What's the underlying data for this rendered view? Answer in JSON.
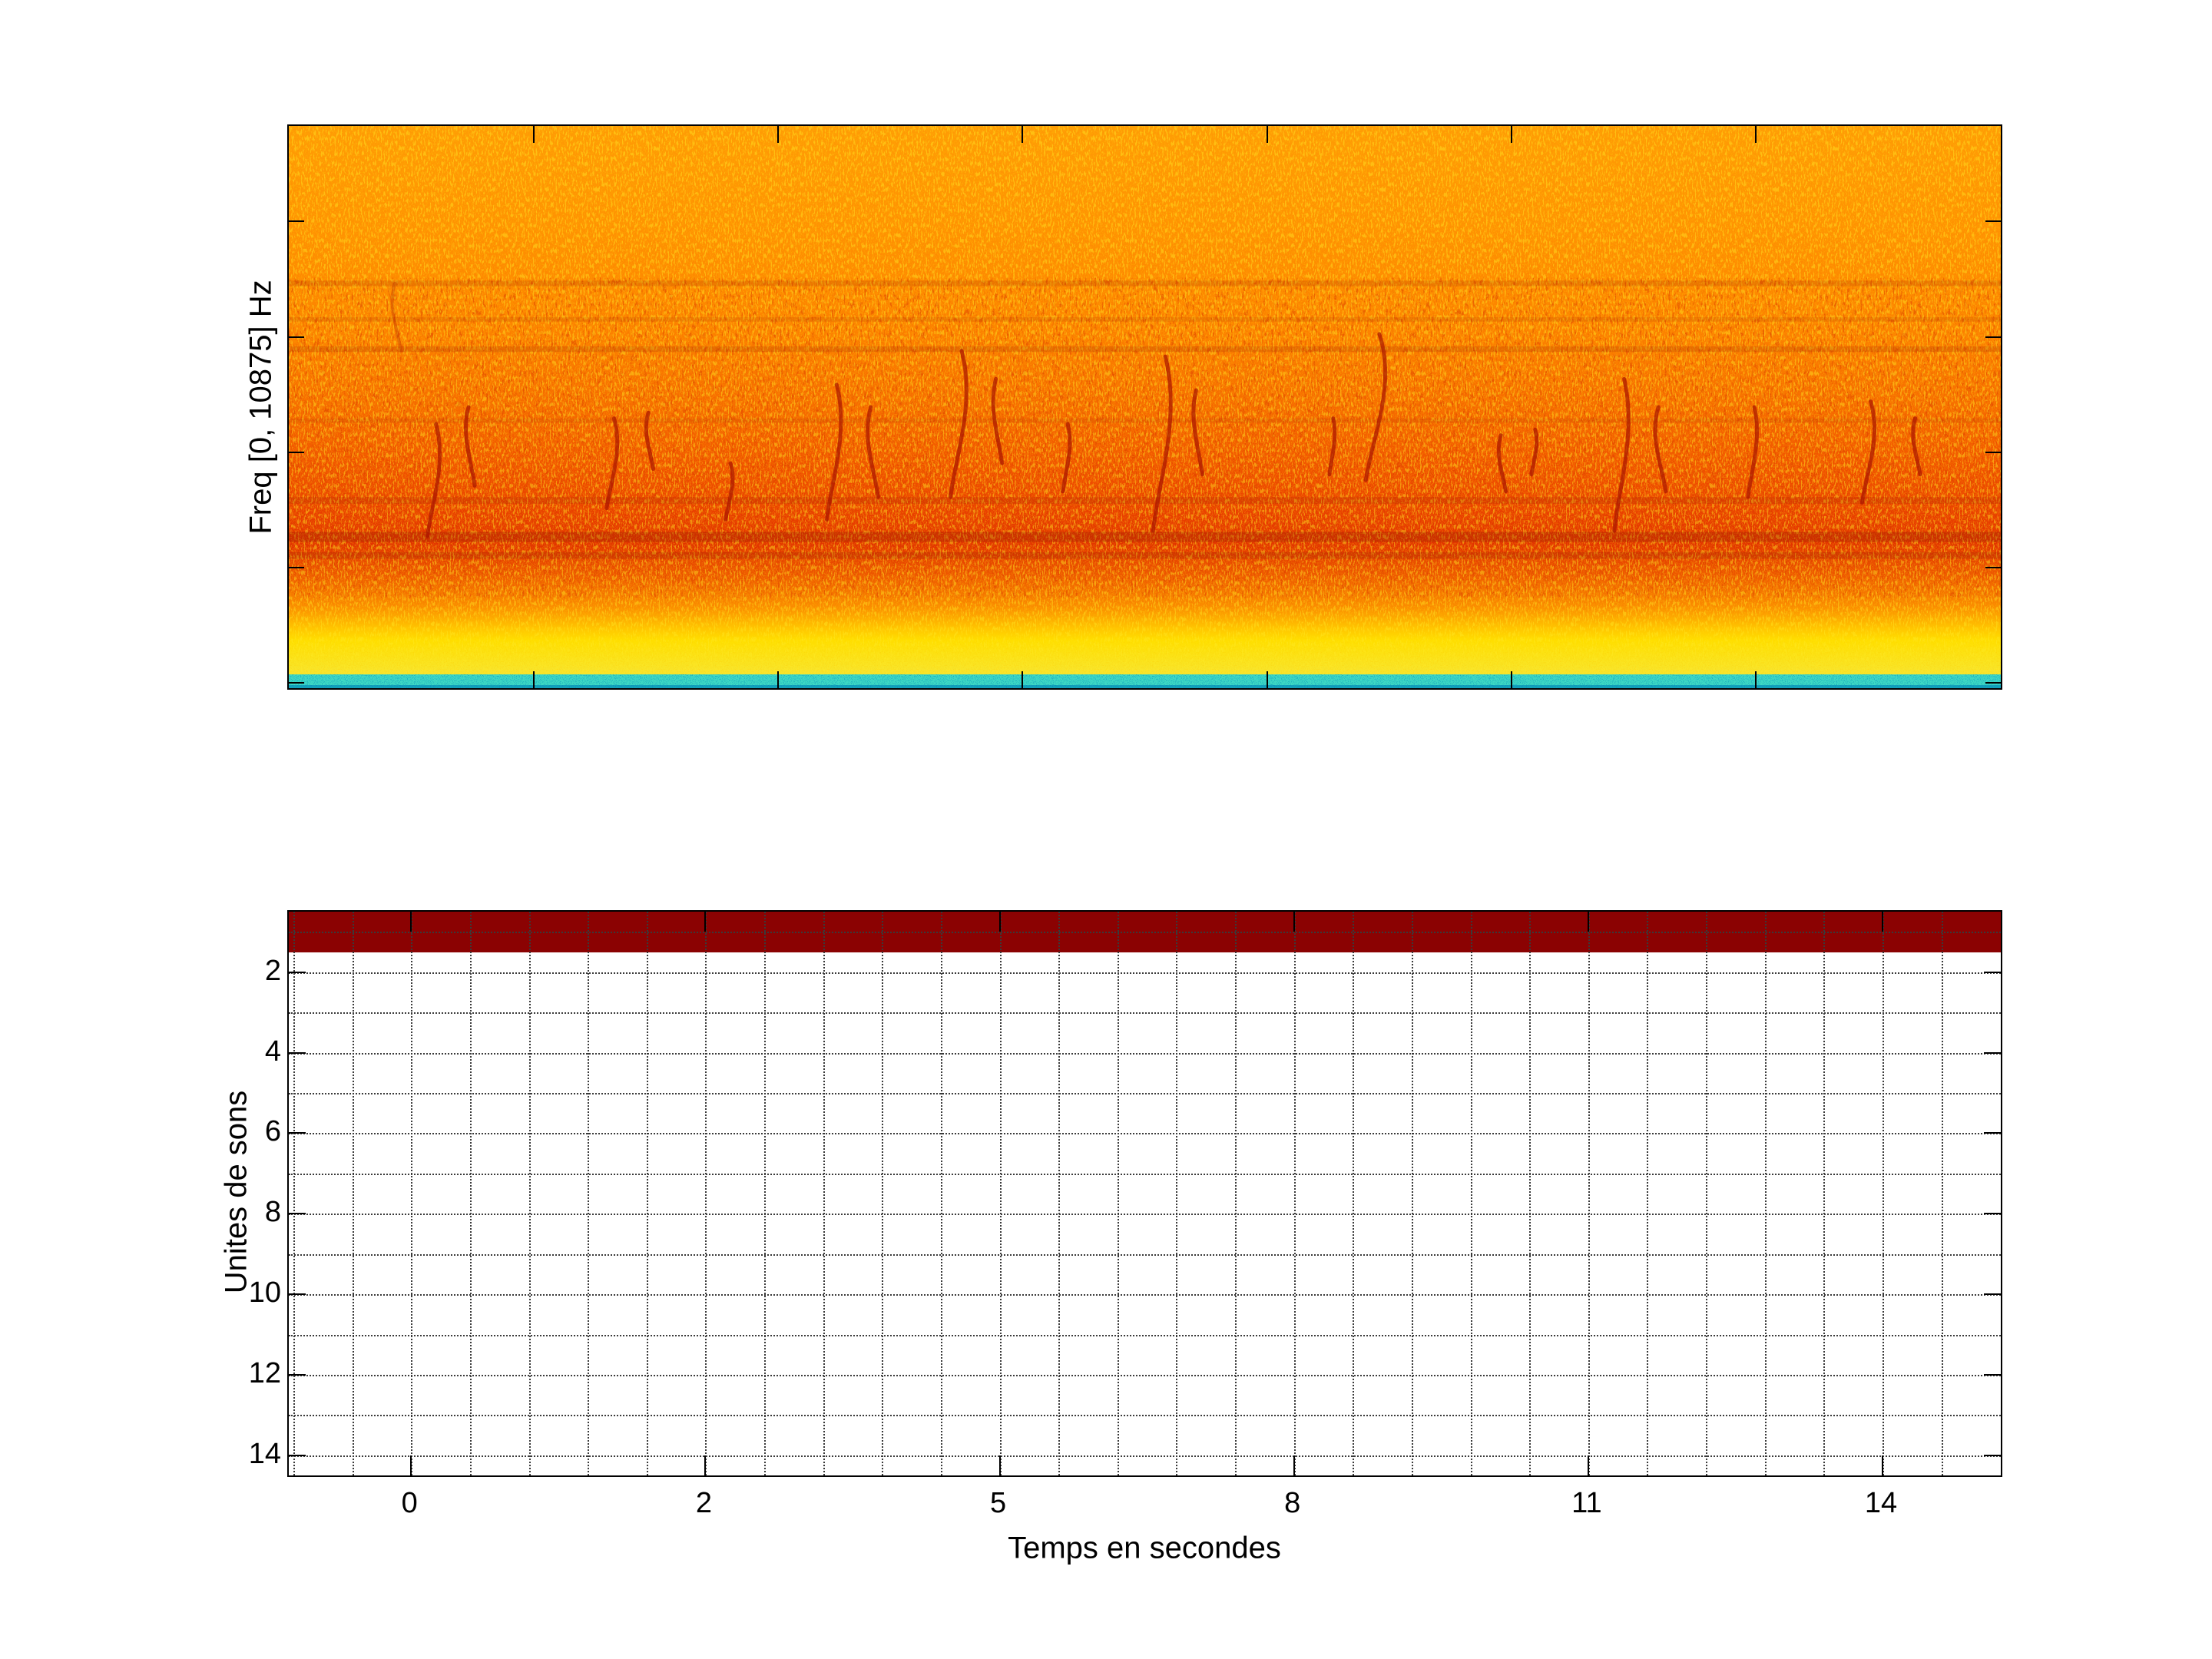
{
  "figure": {
    "background": "#ffffff",
    "axis_color": "#000000",
    "grid_color": "#3a3a3a"
  },
  "chart_data": [
    {
      "id": "spectrogram",
      "type": "heatmap",
      "subtype": "spectrogram",
      "title": "",
      "xlabel": "",
      "ylabel": "Freq [0, 10875] Hz",
      "x_tick_labels": [],
      "y_tick_labels": [],
      "colormap": "jet",
      "legend": "none",
      "description": "Dense orange noise spectrogram; mid-frequency zone darker red containing many short dark-red curved chirp streaks (tonal calls); faint darker horizontal striation bands; bright yellow low-frequency band near the bottom topped by a thin cyan/green strip at the lowest frequencies.",
      "color_zones": [
        [
          0.0,
          "#ff9b05"
        ],
        [
          0.18,
          "#ff9102"
        ],
        [
          0.36,
          "#fc8000"
        ],
        [
          0.5,
          "#f66a00"
        ],
        [
          0.6,
          "#f15400"
        ],
        [
          0.68,
          "#ea4100"
        ],
        [
          0.745,
          "#e23300"
        ],
        [
          0.8,
          "#ee5800"
        ],
        [
          0.855,
          "#fa8b00"
        ],
        [
          0.893,
          "#ffc400"
        ],
        [
          0.915,
          "#ffe000"
        ],
        [
          0.972,
          "#f7e52e"
        ]
      ],
      "cyan_strip": {
        "y": 0.9755,
        "height": 0.021,
        "color": "#3ed8c4",
        "bottom_color": "#14a3bb"
      },
      "horizontal_dark_bands": [
        {
          "y": 0.275,
          "h": 0.01,
          "opacity": 0.16
        },
        {
          "y": 0.34,
          "h": 0.008,
          "opacity": 0.12
        },
        {
          "y": 0.392,
          "h": 0.01,
          "opacity": 0.18
        },
        {
          "y": 0.52,
          "h": 0.008,
          "opacity": 0.1
        },
        {
          "y": 0.66,
          "h": 0.012,
          "opacity": 0.16
        },
        {
          "y": 0.722,
          "h": 0.018,
          "opacity": 0.28
        },
        {
          "y": 0.758,
          "h": 0.012,
          "opacity": 0.2
        }
      ],
      "call_streaks": [
        {
          "x": 0.062,
          "y0": 0.28,
          "y1": 0.4,
          "c": -10,
          "o": 0.3,
          "w": 4
        },
        {
          "x": 0.086,
          "y0": 0.53,
          "y1": 0.73,
          "c": 14
        },
        {
          "x": 0.105,
          "y0": 0.5,
          "y1": 0.64,
          "c": -10
        },
        {
          "x": 0.19,
          "y0": 0.52,
          "y1": 0.68,
          "c": 12
        },
        {
          "x": 0.21,
          "y0": 0.51,
          "y1": 0.61,
          "c": -8
        },
        {
          "x": 0.258,
          "y0": 0.6,
          "y1": 0.7,
          "c": 8
        },
        {
          "x": 0.32,
          "y0": 0.46,
          "y1": 0.7,
          "c": 16
        },
        {
          "x": 0.34,
          "y0": 0.5,
          "y1": 0.66,
          "c": -12
        },
        {
          "x": 0.393,
          "y0": 0.4,
          "y1": 0.66,
          "c": 18
        },
        {
          "x": 0.413,
          "y0": 0.45,
          "y1": 0.6,
          "c": -10
        },
        {
          "x": 0.455,
          "y0": 0.53,
          "y1": 0.65,
          "c": 8
        },
        {
          "x": 0.512,
          "y0": 0.41,
          "y1": 0.72,
          "c": 20
        },
        {
          "x": 0.53,
          "y0": 0.47,
          "y1": 0.62,
          "c": -10
        },
        {
          "x": 0.61,
          "y0": 0.52,
          "y1": 0.62,
          "c": 6
        },
        {
          "x": 0.637,
          "y0": 0.37,
          "y1": 0.63,
          "c": 22
        },
        {
          "x": 0.708,
          "y0": 0.55,
          "y1": 0.65,
          "c": -8
        },
        {
          "x": 0.728,
          "y0": 0.54,
          "y1": 0.62,
          "c": 6
        },
        {
          "x": 0.78,
          "y0": 0.45,
          "y1": 0.72,
          "c": 16
        },
        {
          "x": 0.8,
          "y0": 0.5,
          "y1": 0.65,
          "c": -12
        },
        {
          "x": 0.856,
          "y0": 0.5,
          "y1": 0.66,
          "c": 10
        },
        {
          "x": 0.924,
          "y0": 0.49,
          "y1": 0.67,
          "c": 14
        },
        {
          "x": 0.95,
          "y0": 0.52,
          "y1": 0.62,
          "c": -8
        }
      ],
      "x_ticks_frac": [
        0.1429,
        0.2857,
        0.4286,
        0.5714,
        0.7143,
        0.8571
      ],
      "y_ticks_frac": [
        0.17,
        0.375,
        0.58,
        0.785,
        0.99
      ]
    },
    {
      "id": "sound-units",
      "type": "heatmap",
      "title": "",
      "xlabel": "Temps en secondes",
      "ylabel": "Unites de sons",
      "x_tick_labels": [
        "0",
        "2",
        "5",
        "8",
        "11",
        "14"
      ],
      "y_tick_labels": [
        "2",
        "4",
        "6",
        "8",
        "10",
        "12",
        "14"
      ],
      "y_range": [
        0.5,
        14.5
      ],
      "grid": "dotted gridlines every 1 unit on both axes; solid tick marks on all four box edges at labeled positions",
      "band": {
        "row": 1,
        "y_span": [
          0.5,
          1.5
        ],
        "x_span": "full width",
        "color": "#8b0202"
      },
      "plot_background": "#ffffff"
    }
  ]
}
